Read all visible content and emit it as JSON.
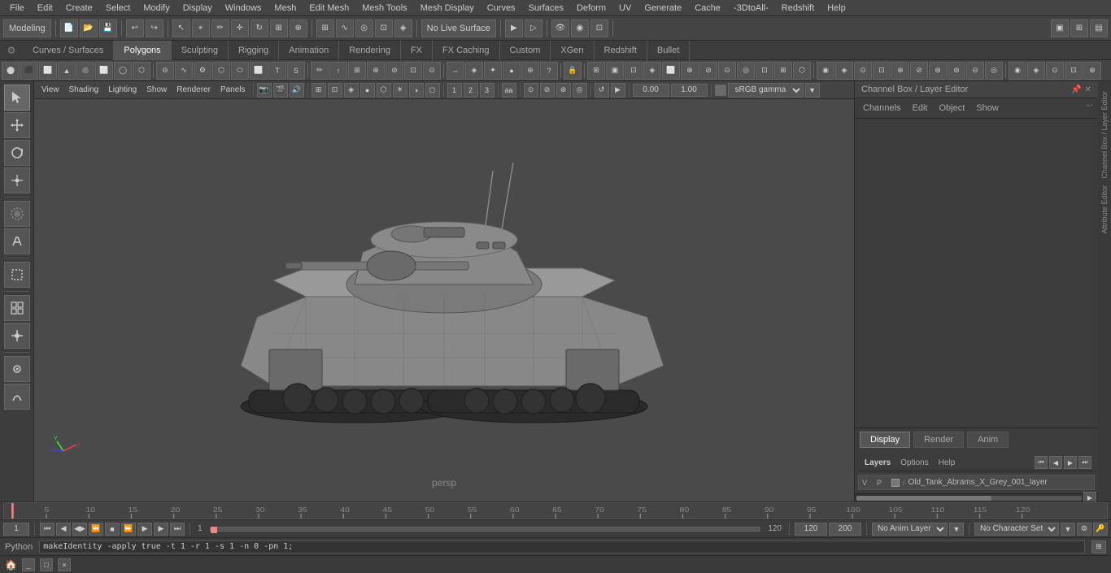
{
  "menu": {
    "items": [
      "File",
      "Edit",
      "Create",
      "Select",
      "Modify",
      "Display",
      "Windows",
      "Mesh",
      "Edit Mesh",
      "Mesh Tools",
      "Mesh Display",
      "Curves",
      "Surfaces",
      "Deform",
      "UV",
      "Generate",
      "Cache",
      "-3DtoAll-",
      "Redshift",
      "Help"
    ]
  },
  "toolbar": {
    "mode_dropdown": "Modeling",
    "undo_label": "↩",
    "redo_label": "↪",
    "live_surface": "No Live Surface"
  },
  "tabs": {
    "items": [
      "Curves / Surfaces",
      "Polygons",
      "Sculpting",
      "Rigging",
      "Animation",
      "Rendering",
      "FX",
      "FX Caching",
      "Custom",
      "XGen",
      "Redshift",
      "Bullet"
    ],
    "active": "Polygons"
  },
  "viewport": {
    "label": "persp",
    "camera_mode": "persp"
  },
  "viewport_toolbar": {
    "view": "View",
    "shading": "Shading",
    "lighting": "Lighting",
    "show": "Show",
    "renderer": "Renderer",
    "panels": "Panels",
    "translate_x": "0.00",
    "translate_y": "1.00",
    "color_space": "sRGB gamma"
  },
  "channel_box": {
    "title": "Channel Box / Layer Editor",
    "tabs": [
      "Channels",
      "Edit",
      "Object",
      "Show"
    ],
    "display_tabs": [
      "Display",
      "Render",
      "Anim"
    ],
    "active_display_tab": "Display"
  },
  "layers": {
    "title": "Layers",
    "options_items": [
      "Options",
      "Help"
    ],
    "layer_name": "Old_Tank_Abrams_X_Grey_001_layer",
    "layer_v": "V",
    "layer_p": "P"
  },
  "playback": {
    "current_frame": "1",
    "frame_start": "1",
    "frame_end": "120",
    "range_start": "120",
    "range_end": "200",
    "anim_layer": "No Anim Layer",
    "character_set": "No Character Set",
    "prev_frame": "◀",
    "next_frame": "▶",
    "play": "▶",
    "stop": "■",
    "prev_key": "◀◀",
    "next_key": "▶▶",
    "goto_start": "⏮",
    "goto_end": "⏭"
  },
  "status_bar": {
    "command": "makeIdentity -apply true -t 1 -r 1 -s 1 -n 0 -pn 1;",
    "python_label": "Python",
    "script_editor_icon": "⊞"
  },
  "timeline": {
    "markers": [
      "5",
      "10",
      "15",
      "20",
      "25",
      "30",
      "35",
      "40",
      "45",
      "50",
      "55",
      "60",
      "65",
      "70",
      "75",
      "80",
      "85",
      "90",
      "95",
      "100",
      "105",
      "110",
      "115",
      "120"
    ]
  },
  "left_tools": {
    "select": "↖",
    "lasso": "⌖",
    "paint": "✏",
    "transform": "⊕",
    "rotate": "↻",
    "marquee": "▣",
    "snap": "⊞",
    "nurbs": "∿",
    "subd": "⊡"
  },
  "right_strips": {
    "channel_box": "Channel Box / Layer Editor",
    "attribute_editor": "Attribute Editor"
  },
  "bottom_window": {
    "icon": "🏠",
    "minimize": "_",
    "restore": "□",
    "close": "×"
  }
}
